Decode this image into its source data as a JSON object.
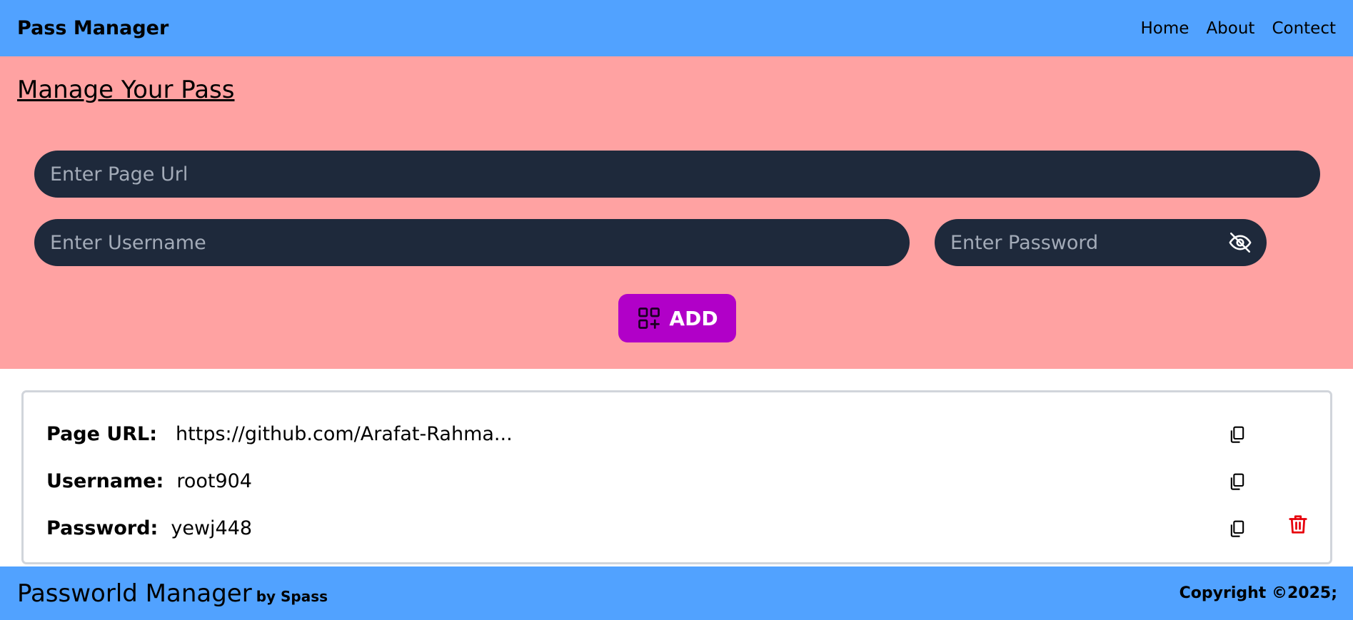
{
  "navbar": {
    "brand": "Pass Manager",
    "links": [
      "Home",
      "About",
      "Contect"
    ],
    "color": "#51a2ff"
  },
  "manager": {
    "title": "Manage Your Pass",
    "url_placeholder": "Enter Page Url",
    "username_placeholder": "Enter Username",
    "password_placeholder": "Enter Password",
    "password_toggle_icon": "eye-off-icon",
    "add_label": "ADD",
    "add_icon": "add-grid-icon",
    "colors": {
      "background": "#ffa2a2",
      "field": "#1e293b",
      "button": "#b100c8"
    }
  },
  "entry": {
    "url_label": "Page URL:",
    "url_value": "https://github.com/Arafat-Rahma...",
    "username_label": "Username:",
    "username_value": "root904",
    "password_label": "Password:",
    "password_value": "yewj448",
    "copy_icon": "copy-icon",
    "delete_icon": "trash-icon",
    "delete_color": "#e7000b"
  },
  "footer": {
    "title": "Passworld Manager",
    "by": "by Spass",
    "copyright": "Copyright ©2025;"
  }
}
